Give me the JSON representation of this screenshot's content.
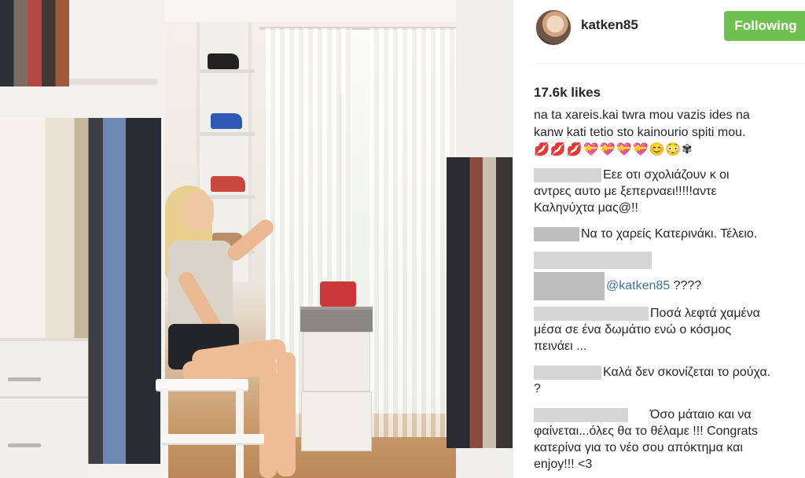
{
  "post": {
    "username": "katken85",
    "follow_button": "Following",
    "likes": "17.6k likes",
    "caption_lines": [
      "na ta xareis.kai twra mou vazis ides na",
      "kanw kati tetio sto kainourio spiti mou."
    ],
    "caption_emojis": "💋💋💋💝💝💝💝😊😳✾",
    "comments": [
      {
        "lines": [
          "Εεε οτι σχολιάζουν κ οι",
          "αντρες αυτο με ξεπερναει!!!!!αντε",
          "Καληνύχτα μας@!!"
        ]
      },
      {
        "lines": [
          "Να το χαρείς Κατερινάκι. Τέλειο."
        ]
      },
      {
        "mention": "@katken85",
        "text": " ????"
      },
      {
        "lines": [
          "Ποσά λεφτά χαμένα",
          "μέσα σε ένα δωμάτιο ενώ ο κόσμος",
          "πεινάει ..."
        ]
      },
      {
        "lines": [
          "Καλά δεν σκονίζεται το ρούχα.",
          "?"
        ]
      },
      {
        "lines": [
          "Όσο μάταιο και να",
          "φαίνεται...όλες θα το θέλαμε !!! Congrats",
          "κατερίνα για το νέο σου απόκτημα και",
          "enjoy!!! <3"
        ]
      }
    ]
  },
  "colors": {
    "follow_green": "#70c050",
    "mention_blue": "#3f729b"
  }
}
